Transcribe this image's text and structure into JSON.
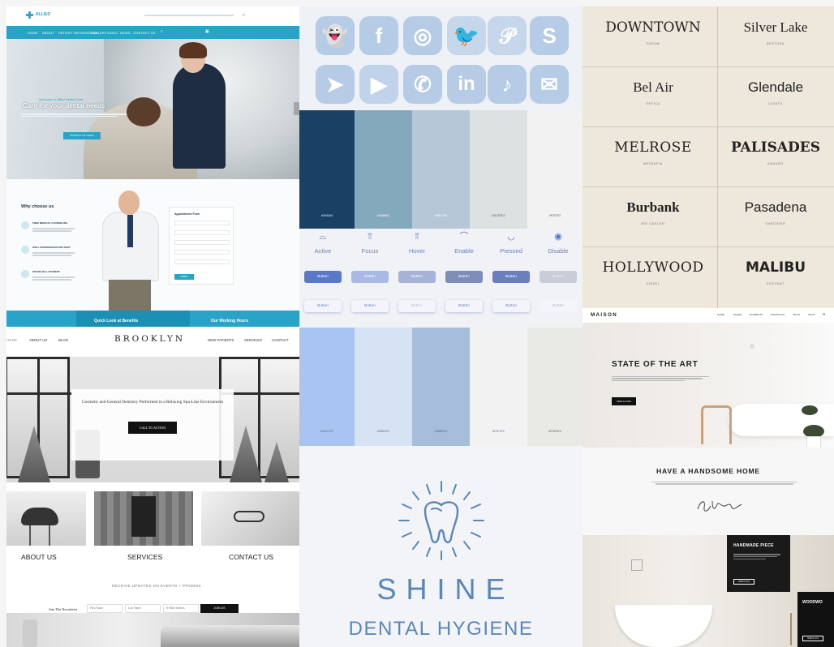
{
  "allied": {
    "brand": "ALLIED",
    "nav": [
      "HOME",
      "ABOUT",
      "PATIENT INFORMATION",
      "GALLERY",
      "VIDEO",
      "NEWS",
      "CONTACT US"
    ],
    "pretitle": "Welcome to Allied Dental Care",
    "hero_title": "Care for your dental needs",
    "cta": "CONTACT US TODAY",
    "why_title": "Why choose us",
    "why_items": [
      "FREE MEDICAL COUNSELING",
      "WELL EXPERIENCED DOCTORS",
      "ONLINE BILL PAYMENT"
    ],
    "appointment_title": "Appointment Form",
    "submit_label": "SUBMIT",
    "benefits_label": "Quick Look at Benefits",
    "hours_label": "Our Working Hours"
  },
  "brooklyn": {
    "nav_left": [
      "HOME",
      "ABOUT US",
      "BLOG"
    ],
    "brand": "BROOKLYN",
    "nav_right": [
      "NEW PATIENTS",
      "SERVICES",
      "CONTACT"
    ],
    "tagline": "Cosmetic and General Dentistry Performed in a Relaxing Spa-Like Environment",
    "cta": "CALL TO ACTION",
    "captions": [
      "ABOUT US",
      "SERVICES",
      "CONTACT US"
    ],
    "newsletter_heading": "RECEIVE UPDATES ON EVENTS + PROMOS",
    "join_label": "Join The Newsletter",
    "fields": [
      "First Name",
      "Last Name",
      "E-Mail Address"
    ],
    "join_button": "JOIN US"
  },
  "social": {
    "icons": [
      "snapchat-icon",
      "facebook-icon",
      "instagram-icon",
      "twitter-icon",
      "pinterest-icon",
      "skype-icon",
      "telegram-icon",
      "youtube-icon",
      "whatsapp-icon",
      "linkedin-icon",
      "tiktok-icon",
      "mail-icon"
    ],
    "glyphs": [
      "👻",
      "f",
      "◎",
      "🐦",
      "𝒫",
      "S",
      "➤",
      "▶",
      "✆",
      "in",
      "♪",
      "✉"
    ]
  },
  "palette1": [
    {
      "hex": "#194164",
      "label": "#194164"
    },
    {
      "hex": "#84A8BC",
      "label": "#84A8BC"
    },
    {
      "hex": "#B6C7D8",
      "label": "#B6C7D8"
    },
    {
      "hex": "#DCE2E2",
      "label": "#DCE2E2"
    },
    {
      "hex": "#F2F2F2",
      "label": "#F2F2F2"
    }
  ],
  "states": {
    "labels": [
      "Active",
      "Focus",
      "Hover",
      "Enable",
      "Pressed",
      "Disable"
    ],
    "glyphs": [
      "⌓",
      "⫪",
      "⫪",
      "⌒",
      "◡",
      "◉"
    ],
    "button_label": "Button",
    "colors": [
      "#5a78c8",
      "#a9b9e6",
      "#a6b2d8",
      "#7d8cb8",
      "#6b7fbf",
      "#c9cdd8"
    ]
  },
  "palette2": [
    {
      "hex": "#A8C5F2",
      "label": "#A8CCF2"
    },
    {
      "hex": "#D5E3F4",
      "label": "#D5E2F2"
    },
    {
      "hex": "#A6BEDB",
      "label": "#A6BED9"
    },
    {
      "hex": "#F2F2F2",
      "label": "#F2F2F2"
    },
    {
      "hex": "#E9E9E6",
      "label": "#E9E9E6"
    }
  ],
  "shine": {
    "title": "SHINE",
    "subtitle": "DENTAL HYGIENE",
    "color": "#5b86b8"
  },
  "fonts": [
    {
      "name": "DOWNTOWN",
      "sub": "FORUM"
    },
    {
      "name": "Silver Lake",
      "sub": "RESTORA"
    },
    {
      "name": "Bel Air",
      "sub": "ORTICA"
    },
    {
      "name": "Glendale",
      "sub": "LOVATO"
    },
    {
      "name": "MELROSE",
      "sub": "MESSAPIA"
    },
    {
      "name": "PALISADES",
      "sub": "AMAURO"
    },
    {
      "name": "Burbank",
      "sub": "BIG CASLON"
    },
    {
      "name": "Pasadena",
      "sub": "GAROGIER"
    },
    {
      "name": "HOLLYWOOD",
      "sub": "CINZEL"
    },
    {
      "name": "MALIBU",
      "sub": "COCONAT"
    }
  ],
  "maison": {
    "brand": "MAISON",
    "nav": [
      "HOME",
      "PAGES",
      "ELEMENTS",
      "PORTFOLIO",
      "BLOG",
      "SHOP"
    ],
    "hero_title": "STATE OF THE ART",
    "hero_button": "TAKE A LOOK",
    "mid_title": "HAVE A HANDSOME HOME",
    "card_title": "HANDMADE PIECE",
    "card_button": "CHECK OUT",
    "card2_title": "WOODWO",
    "card2_button": "CHECK OUT"
  }
}
